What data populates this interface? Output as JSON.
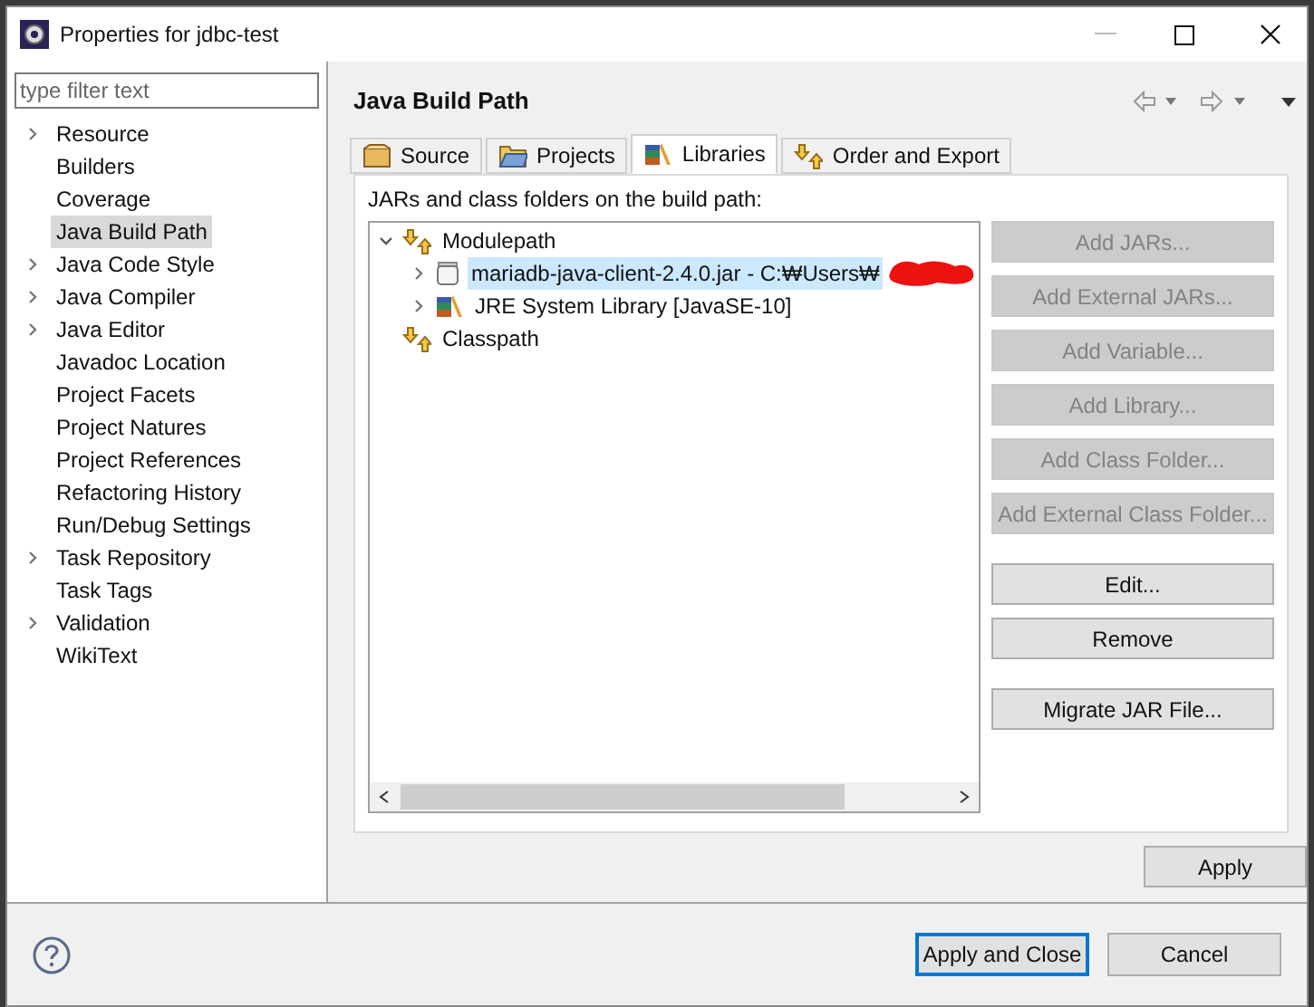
{
  "window": {
    "title": "Properties for jdbc-test"
  },
  "filter": {
    "placeholder": "type filter text"
  },
  "nav": [
    {
      "label": "Resource",
      "expandable": true,
      "selected": false
    },
    {
      "label": "Builders",
      "expandable": false,
      "selected": false
    },
    {
      "label": "Coverage",
      "expandable": false,
      "selected": false
    },
    {
      "label": "Java Build Path",
      "expandable": false,
      "selected": true
    },
    {
      "label": "Java Code Style",
      "expandable": true,
      "selected": false
    },
    {
      "label": "Java Compiler",
      "expandable": true,
      "selected": false
    },
    {
      "label": "Java Editor",
      "expandable": true,
      "selected": false
    },
    {
      "label": "Javadoc Location",
      "expandable": false,
      "selected": false
    },
    {
      "label": "Project Facets",
      "expandable": false,
      "selected": false
    },
    {
      "label": "Project Natures",
      "expandable": false,
      "selected": false
    },
    {
      "label": "Project References",
      "expandable": false,
      "selected": false
    },
    {
      "label": "Refactoring History",
      "expandable": false,
      "selected": false
    },
    {
      "label": "Run/Debug Settings",
      "expandable": false,
      "selected": false
    },
    {
      "label": "Task Repository",
      "expandable": true,
      "selected": false
    },
    {
      "label": "Task Tags",
      "expandable": false,
      "selected": false
    },
    {
      "label": "Validation",
      "expandable": true,
      "selected": false
    },
    {
      "label": "WikiText",
      "expandable": false,
      "selected": false
    }
  ],
  "page_title": "Java Build Path",
  "tabs": [
    {
      "label": "Source",
      "kind": "source",
      "selected": false
    },
    {
      "label": "Projects",
      "kind": "projects",
      "selected": false
    },
    {
      "label": "Libraries",
      "kind": "libraries",
      "selected": true
    },
    {
      "label": "Order and Export",
      "kind": "order",
      "selected": false
    }
  ],
  "description": "JARs and class folders on the build path:",
  "tree": [
    {
      "label": "Modulepath",
      "kind": "container",
      "expandable": true,
      "expanded": true,
      "selected": false,
      "children": [
        {
          "label": "mariadb-java-client-2.4.0.jar - C:₩Users₩",
          "kind": "jar",
          "expandable": true,
          "expanded": false,
          "selected": true,
          "redacted": true
        },
        {
          "label": "JRE System Library [JavaSE-10]",
          "kind": "jre",
          "expandable": true,
          "expanded": false,
          "selected": false,
          "redacted": false
        }
      ]
    },
    {
      "label": "Classpath",
      "kind": "container",
      "expandable": false,
      "selected": false
    }
  ],
  "side_button_groups": [
    [
      {
        "label": "Add JARs...",
        "disabled": true
      },
      {
        "label": "Add External JARs...",
        "disabled": true
      },
      {
        "label": "Add Variable...",
        "disabled": true
      },
      {
        "label": "Add Library...",
        "disabled": true
      },
      {
        "label": "Add Class Folder...",
        "disabled": true
      },
      {
        "label": "Add External Class Folder...",
        "disabled": true
      }
    ],
    [
      {
        "label": "Edit...",
        "disabled": false
      },
      {
        "label": "Remove",
        "disabled": false
      }
    ],
    [
      {
        "label": "Migrate JAR File...",
        "disabled": false
      }
    ]
  ],
  "apply": "Apply",
  "footer_buttons": [
    {
      "label": "Apply and Close",
      "default": true
    },
    {
      "label": "Cancel",
      "default": false
    }
  ]
}
